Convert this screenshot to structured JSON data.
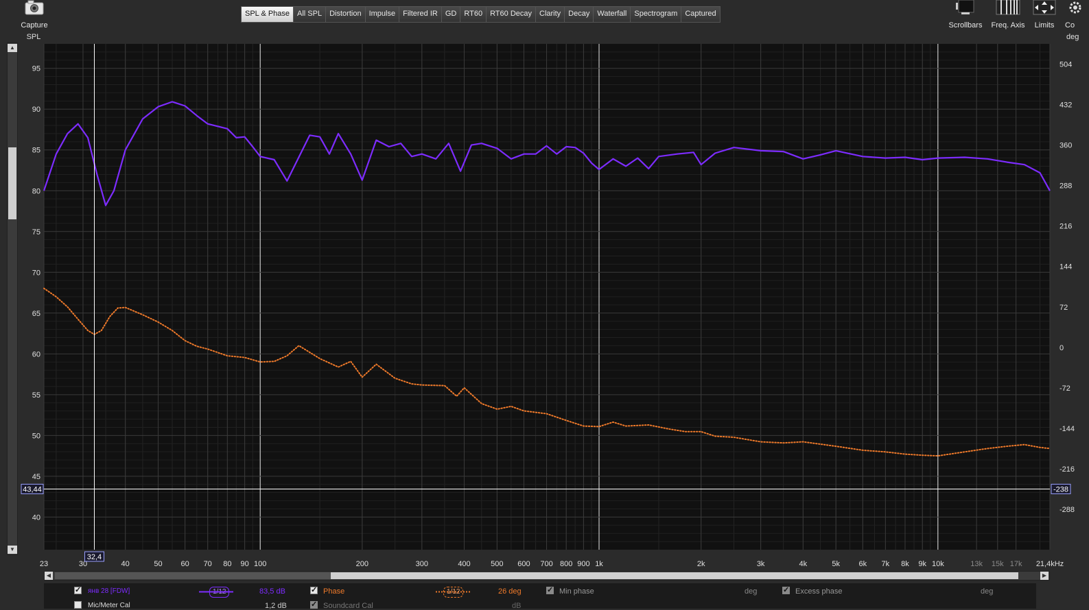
{
  "toolbar": {
    "capture_label": "Capture",
    "tabs": [
      "SPL & Phase",
      "All SPL",
      "Distortion",
      "Impulse",
      "Filtered IR",
      "GD",
      "RT60",
      "RT60 Decay",
      "Clarity",
      "Decay",
      "Waterfall",
      "Spectrogram",
      "Captured"
    ],
    "active_tab": "SPL & Phase",
    "right_tools": [
      "Scrollbars",
      "Freq. Axis",
      "Limits",
      "Co"
    ]
  },
  "colors": {
    "spl_trace": "#7d2cff",
    "phase_trace": "#f07a2a",
    "plot_bg": "#111111",
    "grid": "#3a3a3a"
  },
  "cursor": {
    "freq_label": "32,4",
    "spl_label": "43,44",
    "phase_label": "-238"
  },
  "legend": {
    "row1": {
      "measurement_name": "янв 28 [FDW]",
      "spl_smoothing": "1/12",
      "spl_value": "83,5 dB",
      "phase_label": "Phase",
      "phase_smoothing": "1/12",
      "phase_value": "26 deg",
      "min_phase_label": "Min phase",
      "min_phase_unit": "deg",
      "excess_phase_label": "Excess phase",
      "excess_phase_unit": "deg"
    },
    "row2": {
      "mic_cal_label": "Mic/Meter Cal",
      "mic_cal_value": "1,2 dB",
      "soundcard_cal_label": "Soundcard Cal",
      "soundcard_cal_unit": "dB"
    }
  },
  "chart_data": {
    "type": "line",
    "xscale": "log",
    "xlim": [
      23,
      21400
    ],
    "ylim": [
      36,
      98
    ],
    "ylabel": "SPL",
    "y2label": "deg",
    "y2lim": [
      -360,
      540
    ],
    "xlabel_unit": "Hz",
    "grid": true,
    "x_ticks": [
      {
        "f": 23,
        "label": "23"
      },
      {
        "f": 30,
        "label": "30"
      },
      {
        "f": 40,
        "label": "40"
      },
      {
        "f": 50,
        "label": "50"
      },
      {
        "f": 60,
        "label": "60"
      },
      {
        "f": 70,
        "label": "70"
      },
      {
        "f": 80,
        "label": "80"
      },
      {
        "f": 90,
        "label": "90"
      },
      {
        "f": 100,
        "label": "100"
      },
      {
        "f": 200,
        "label": "200"
      },
      {
        "f": 300,
        "label": "300"
      },
      {
        "f": 400,
        "label": "400"
      },
      {
        "f": 500,
        "label": "500"
      },
      {
        "f": 600,
        "label": "600"
      },
      {
        "f": 700,
        "label": "700"
      },
      {
        "f": 800,
        "label": "800"
      },
      {
        "f": 900,
        "label": "900"
      },
      {
        "f": 1000,
        "label": "1k"
      },
      {
        "f": 2000,
        "label": "2k"
      },
      {
        "f": 3000,
        "label": "3k"
      },
      {
        "f": 4000,
        "label": "4k"
      },
      {
        "f": 5000,
        "label": "5k"
      },
      {
        "f": 6000,
        "label": "6k"
      },
      {
        "f": 7000,
        "label": "7k"
      },
      {
        "f": 8000,
        "label": "8k"
      },
      {
        "f": 9000,
        "label": "9k"
      },
      {
        "f": 10000,
        "label": "10k"
      },
      {
        "f": 13000,
        "label": "13k"
      },
      {
        "f": 15000,
        "label": "15k"
      },
      {
        "f": 17000,
        "label": "17k"
      },
      {
        "f": 21400,
        "label": "21,4kHz"
      }
    ],
    "y_ticks": [
      40,
      45,
      50,
      55,
      60,
      65,
      70,
      75,
      80,
      85,
      90,
      95
    ],
    "y2_ticks": [
      -288,
      -216,
      -144,
      -72,
      0,
      72,
      144,
      216,
      288,
      360,
      432,
      504
    ],
    "series": [
      {
        "axis": "left",
        "x": [
          23,
          25,
          27,
          29,
          31,
          33,
          35,
          37,
          40,
          45,
          50,
          55,
          60,
          65,
          70,
          80,
          85,
          90,
          95,
          100,
          110,
          120,
          140,
          150,
          160,
          170,
          185,
          200,
          220,
          240,
          260,
          280,
          300,
          330,
          360,
          390,
          420,
          450,
          500,
          550,
          600,
          650,
          700,
          750,
          800,
          850,
          900,
          950,
          1000,
          1100,
          1200,
          1300,
          1400,
          1500,
          1700,
          1900,
          2000,
          2200,
          2500,
          3000,
          3500,
          4000,
          4500,
          5000,
          6000,
          7000,
          8000,
          9000,
          10000,
          12000,
          14000,
          16000,
          18000,
          20000,
          21400
        ],
        "values": [
          80,
          84.5,
          87,
          88.2,
          86.5,
          82,
          78.2,
          80,
          85,
          88.8,
          90.3,
          90.9,
          90.4,
          89.2,
          88.2,
          87.6,
          86.5,
          86.6,
          85.4,
          84.2,
          83.8,
          81.2,
          86.8,
          86.6,
          84.5,
          87,
          84.5,
          81.3,
          86.2,
          85.4,
          85.8,
          84.2,
          84.5,
          83.9,
          85.8,
          82.4,
          85.6,
          85.8,
          85.2,
          83.9,
          84.5,
          84.5,
          85.5,
          84.5,
          85.4,
          85.3,
          84.6,
          83.4,
          82.6,
          83.9,
          83,
          84,
          82.7,
          84.2,
          84.5,
          84.7,
          83.2,
          84.6,
          85.3,
          84.9,
          84.8,
          83.9,
          84.4,
          84.9,
          84.2,
          84,
          84.1,
          83.8,
          84,
          84.1,
          83.9,
          83.5,
          83.2,
          82.2,
          80
        ]
      },
      {
        "axis": "right",
        "x": [
          23,
          25,
          27,
          29,
          31,
          32.4,
          34,
          36,
          38,
          40,
          45,
          50,
          55,
          60,
          65,
          70,
          80,
          90,
          100,
          110,
          120,
          130,
          150,
          170,
          185,
          200,
          220,
          250,
          280,
          300,
          350,
          380,
          400,
          450,
          500,
          550,
          600,
          700,
          800,
          900,
          1000,
          1100,
          1200,
          1400,
          1600,
          1800,
          2000,
          2200,
          2500,
          3000,
          3500,
          4000,
          5000,
          6000,
          7000,
          8000,
          9000,
          10000,
          12000,
          14000,
          16000,
          18000,
          20000,
          21400
        ],
        "values": [
          105,
          90,
          72,
          50,
          30,
          23,
          30,
          55,
          70,
          71,
          58,
          45,
          30,
          12,
          2,
          -3,
          -15,
          -18,
          -26,
          -25,
          -15,
          3,
          -20,
          -35,
          -25,
          -53,
          -30,
          -55,
          -65,
          -67,
          -68,
          -87,
          -72,
          -100,
          -110,
          -105,
          -113,
          -118,
          -130,
          -140,
          -141,
          -133,
          -140,
          -138,
          -145,
          -150,
          -150,
          -158,
          -160,
          -168,
          -170,
          -168,
          -176,
          -183,
          -186,
          -190,
          -192,
          -193,
          -186,
          -180,
          -176,
          -173,
          -178,
          -180
        ]
      }
    ]
  }
}
